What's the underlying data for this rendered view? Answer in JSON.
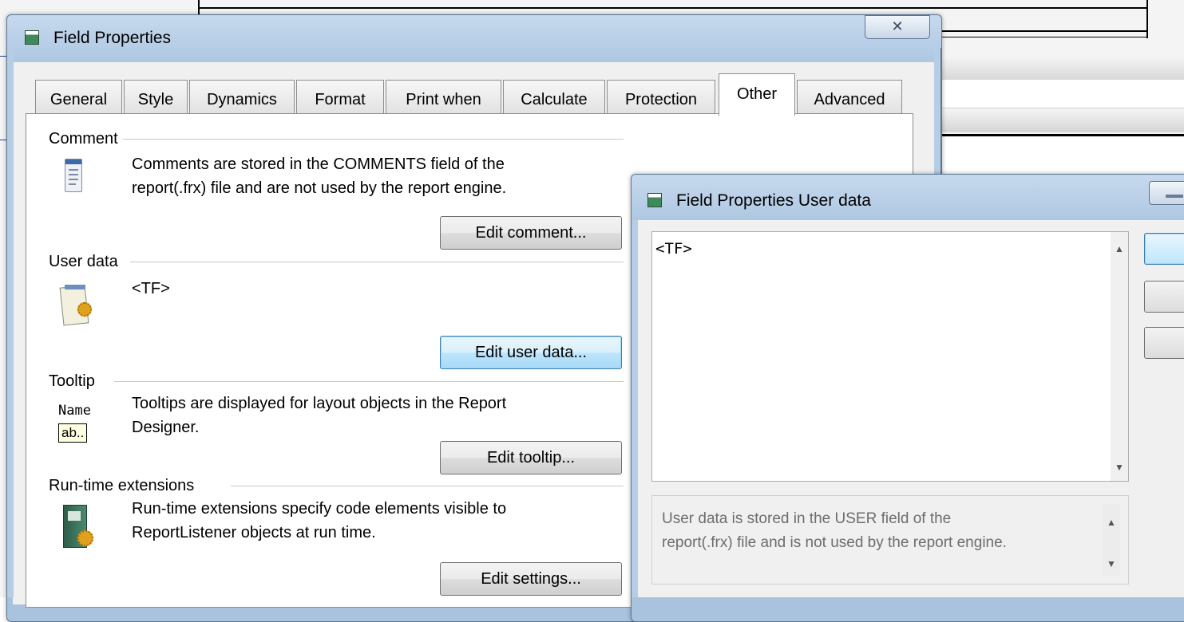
{
  "main_dialog": {
    "title": "Field Properties",
    "close_glyph": "✕",
    "tabs": [
      "General",
      "Style",
      "Dynamics",
      "Format",
      "Print when",
      "Calculate",
      "Protection",
      "Other",
      "Advanced"
    ],
    "active_tab": "Other",
    "sections": {
      "comment": {
        "label": "Comment",
        "description_lines": [
          "Comments are stored in the COMMENTS field of the",
          "report(.frx) file and are not used by the report engine."
        ],
        "button": "Edit comment..."
      },
      "user_data": {
        "label": "User data",
        "value": "<TF>",
        "button": "Edit user data..."
      },
      "tooltip": {
        "label": "Tooltip",
        "description_lines": [
          "Tooltips are displayed for layout objects in the Report",
          "Designer."
        ],
        "icon_top": "Name",
        "icon_box": "ab..",
        "button": "Edit tooltip..."
      },
      "runtime_extensions": {
        "label": "Run-time extensions",
        "description_lines": [
          "Run-time extensions specify code elements visible to",
          "ReportListener objects at run time."
        ],
        "button": "Edit settings..."
      }
    }
  },
  "user_data_dialog": {
    "title": "Field Properties User data",
    "editor_value": "<TF>",
    "info_lines": [
      "User data is stored in the USER field of the",
      "report(.frx) file and is not used by the report engine."
    ]
  },
  "icons": {
    "title": "form-icon",
    "comment": "notepad-icon",
    "user_data": "notepad-gear-icon",
    "runtime": "book-gear-icon"
  },
  "colors": {
    "window_frame": "#b6cde6",
    "client": "#f0f0f0",
    "focus_border": "#3c7fb1"
  }
}
